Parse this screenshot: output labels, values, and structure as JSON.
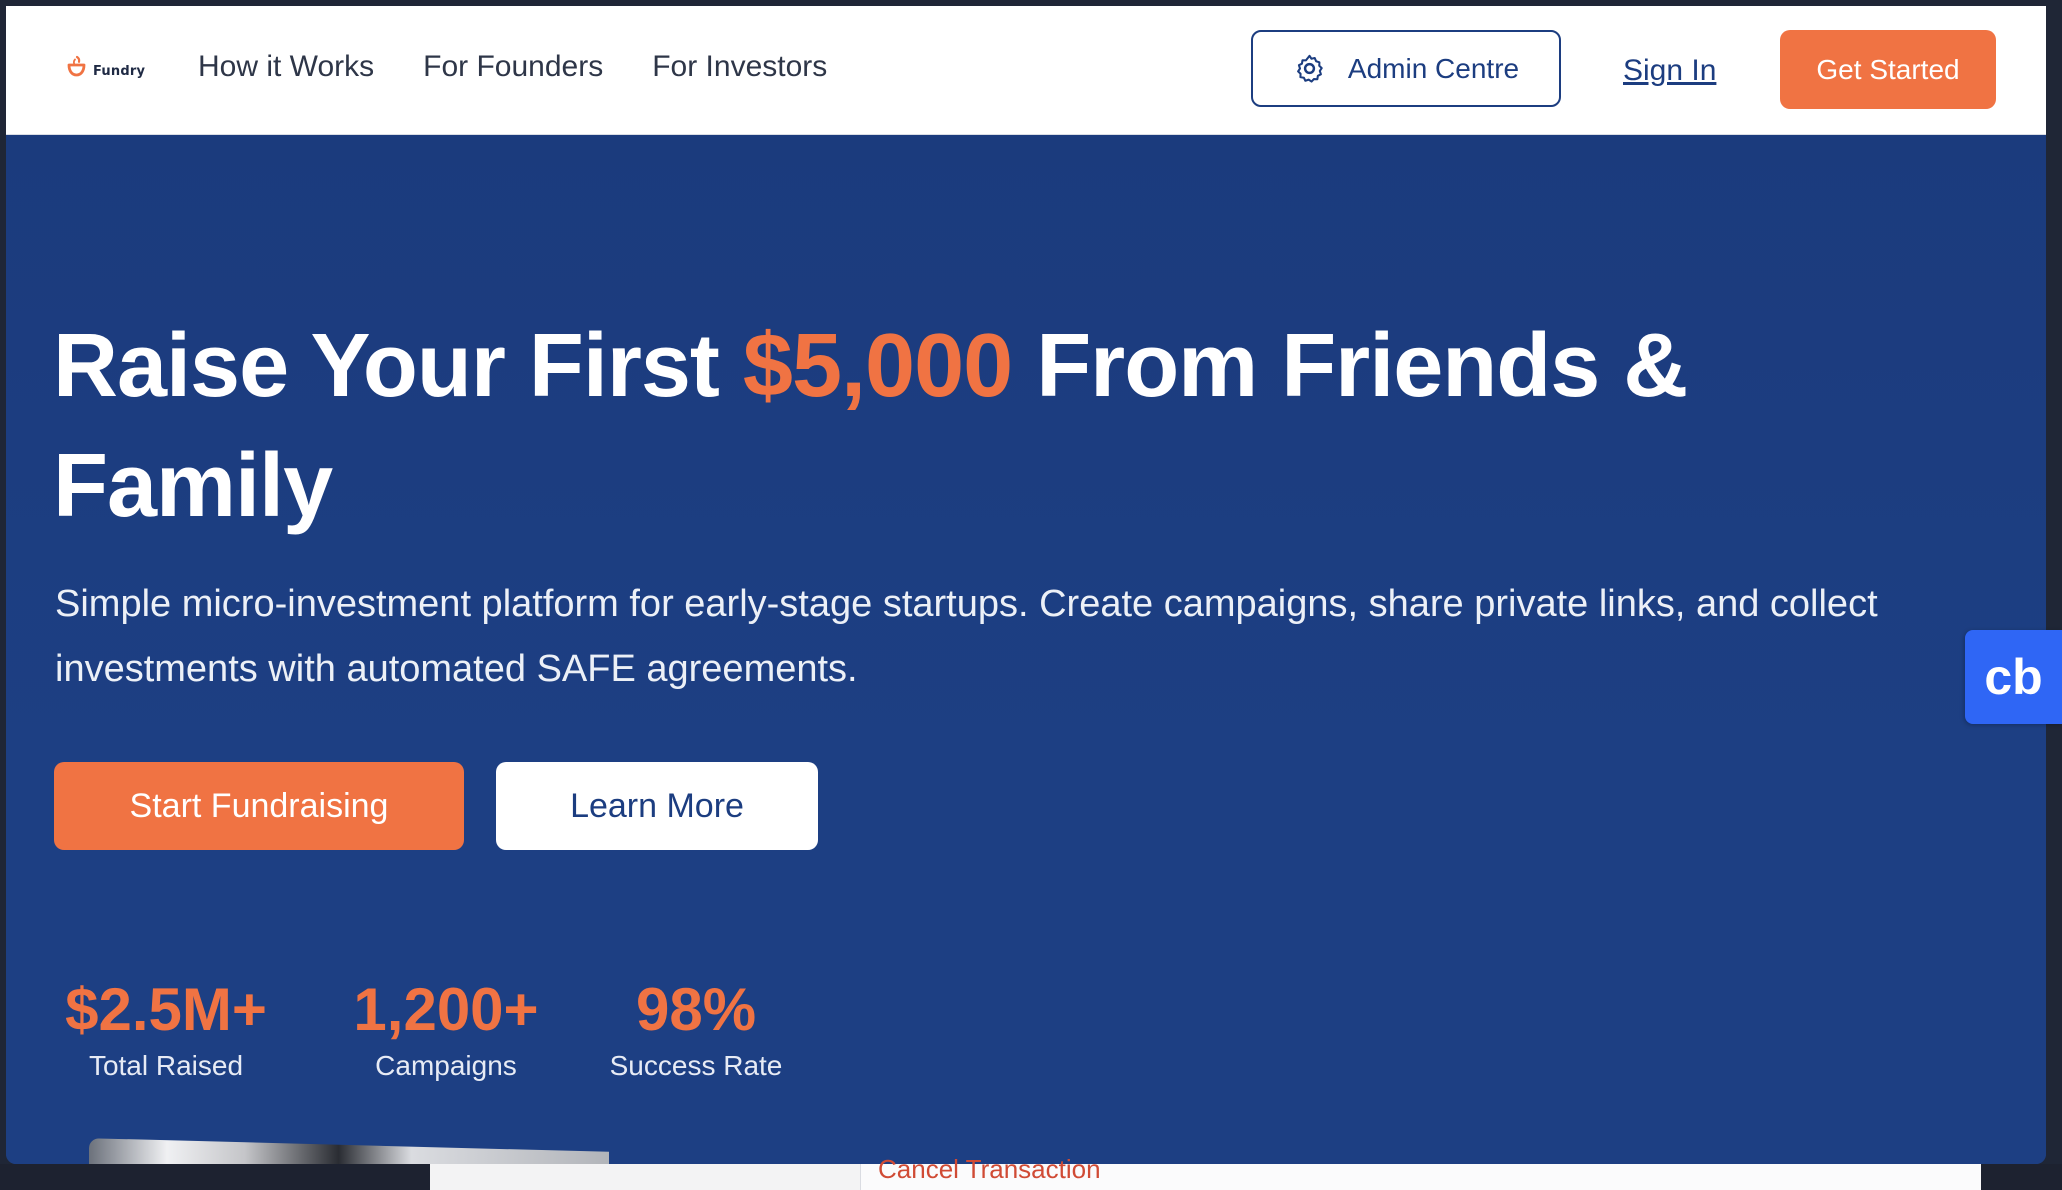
{
  "brand": {
    "name": "Fundry",
    "accent_color": "#f07343",
    "primary_color": "#1c3d80",
    "widget_color": "#2f66f5"
  },
  "nav": {
    "links": [
      {
        "label": "How it Works"
      },
      {
        "label": "For Founders"
      },
      {
        "label": "For Investors"
      }
    ],
    "admin_label": "Admin Centre",
    "signin_label": "Sign In",
    "getstarted_label": "Get Started"
  },
  "hero": {
    "title_part1": "Raise Your First ",
    "title_amount": "$5,000",
    "title_part2": " From Friends & Family",
    "subtitle": "Simple micro-investment platform for early-stage startups. Create campaigns, share private links, and collect investments with automated SAFE agreements.",
    "primary_cta": "Start Fundraising",
    "secondary_cta": "Learn More"
  },
  "stats": [
    {
      "value": "$2.5M+",
      "label": "Total Raised"
    },
    {
      "value": "1,200+",
      "label": "Campaigns"
    },
    {
      "value": "98%",
      "label": "Success Rate"
    }
  ],
  "widget": {
    "label": "cb"
  },
  "background_peek": {
    "text": "Cancel Transaction"
  }
}
